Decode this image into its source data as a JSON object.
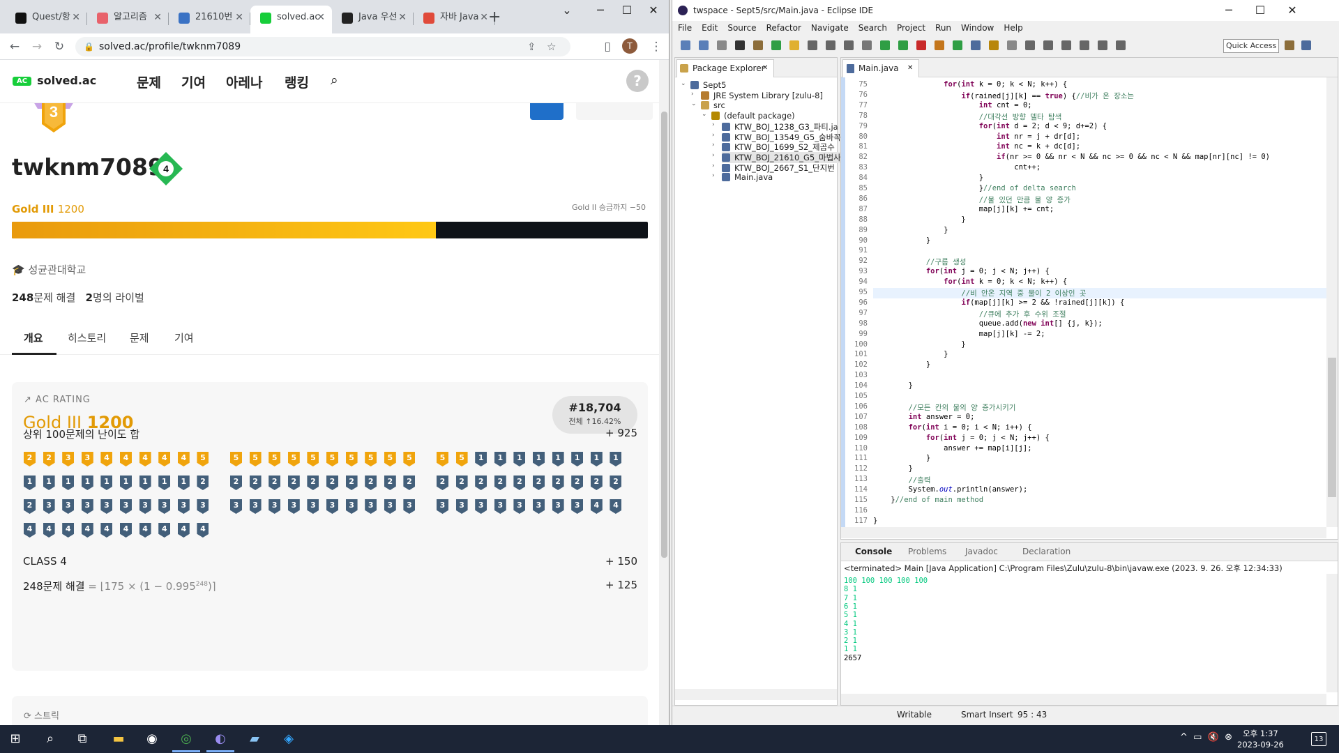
{
  "chrome": {
    "tabs": [
      {
        "label": "Quest/항",
        "fav_color": "#111111"
      },
      {
        "label": "알고리즘",
        "fav_color": "#e8626b"
      },
      {
        "label": "21610번",
        "fav_color": "#3a72c4"
      },
      {
        "label": "solved.ac",
        "fav_color": "#17ce3a",
        "active": true
      },
      {
        "label": "Java 우선",
        "fav_color": "#222222"
      },
      {
        "label": "자바 Java",
        "fav_color": "#e04a3a"
      }
    ],
    "url": "solved.ac/profile/twknm7089",
    "avatar_letter": "T"
  },
  "site": {
    "logo_badge": "AC",
    "logo": "solved.ac",
    "menu": [
      "문제",
      "기여",
      "아레나",
      "랭킹"
    ],
    "help": "?",
    "tier_badge_num": "3",
    "username": "twknm7089",
    "level": "4",
    "tier_name": "Gold III",
    "tier_rating": "1200",
    "next_tier": "Gold II 승급까지 −50",
    "progress": 0.667,
    "school": "성균관대학교",
    "solved_count": "248",
    "solved_label": "문제 해결",
    "rival_count": "2",
    "rival_label": "명의 라이벌",
    "tabs": [
      "개요",
      "히스토리",
      "문제",
      "기여"
    ],
    "card": {
      "header": "AC RATING",
      "tier_name": "Gold III",
      "rating": "1200",
      "rank": "#18,704",
      "rank_sub": "전체 ↑16.42%",
      "top100_label": "상위 100문제의 난이도 합",
      "top100_value": "+ 925",
      "class_label": "CLASS 4",
      "class_value": "+ 150",
      "solved_formula_a": "248문제 해결",
      "solved_formula_b": " = ⌊175 × (1 − 0.995",
      "solved_formula_sup": "248",
      "solved_formula_c": ")⌉",
      "solved_value": "+ 125"
    },
    "streak_label": "스트릭",
    "badge_rows": [
      [
        "g2",
        "g2",
        "g3",
        "g3",
        "g4",
        "g4",
        "g4",
        "g4",
        "g4",
        "g5"
      ],
      [
        "g5",
        "g5",
        "g5",
        "g5",
        "g5",
        "g5",
        "g5",
        "g5",
        "g5",
        "g5"
      ],
      [
        "g5",
        "g5",
        "s1",
        "s1",
        "s1",
        "s1",
        "s1",
        "s1",
        "s1",
        "s1"
      ],
      [
        "s1",
        "s1",
        "s1",
        "s1",
        "s1",
        "s1",
        "s1",
        "s1",
        "s1",
        "s2"
      ],
      [
        "s2",
        "s2",
        "s2",
        "s2",
        "s2",
        "s2",
        "s2",
        "s2",
        "s2",
        "s2"
      ],
      [
        "s2",
        "s2",
        "s2",
        "s2",
        "s2",
        "s2",
        "s2",
        "s2",
        "s2",
        "s2"
      ],
      [
        "s2",
        "s3",
        "s3",
        "s3",
        "s3",
        "s3",
        "s3",
        "s3",
        "s3",
        "s3"
      ],
      [
        "s3",
        "s3",
        "s3",
        "s3",
        "s3",
        "s3",
        "s3",
        "s3",
        "s3",
        "s3"
      ],
      [
        "s3",
        "s3",
        "s3",
        "s3",
        "s3",
        "s3",
        "s3",
        "s3",
        "s4",
        "s4"
      ],
      [
        "s4",
        "s4",
        "s4",
        "s4",
        "s4",
        "s4",
        "s4",
        "s4",
        "s4",
        "s4"
      ]
    ],
    "badge_colors": {
      "gold": "#f0a40c",
      "silver": "#435f7a"
    }
  },
  "eclipse": {
    "title": "twspace - Sept5/src/Main.java - Eclipse IDE",
    "menu": [
      "File",
      "Edit",
      "Source",
      "Refactor",
      "Navigate",
      "Search",
      "Project",
      "Run",
      "Window",
      "Help"
    ],
    "quick_access": "Quick Access",
    "pkg_tab": "Package Explorer",
    "tree": [
      {
        "label": "Sept5",
        "depth": 0
      },
      {
        "label": "JRE System Library [zulu-8]",
        "depth": 1
      },
      {
        "label": "src",
        "depth": 1
      },
      {
        "label": "(default package)",
        "depth": 2
      },
      {
        "label": "KTW_BOJ_1238_G3_파티.ja",
        "depth": 3
      },
      {
        "label": "KTW_BOJ_13549_G5_숨바꼭",
        "depth": 3
      },
      {
        "label": "KTW_BOJ_1699_S2_제곱수",
        "depth": 3
      },
      {
        "label": "KTW_BOJ_21610_G5_마법사",
        "depth": 3
      },
      {
        "label": "KTW_BOJ_2667_S1_단지번",
        "depth": 3
      },
      {
        "label": "Main.java",
        "depth": 3
      }
    ],
    "editor_tab": "Main.java",
    "line_numbers": [
      "75",
      "76",
      "77",
      "78",
      "79",
      "80",
      "81",
      "82",
      "83",
      "84",
      "85",
      "86",
      "87",
      "88",
      "89",
      "90",
      "91",
      "92",
      "93",
      "94",
      "95",
      "96",
      "97",
      "98",
      "99",
      "100",
      "101",
      "102",
      "103",
      "104",
      "105",
      "106",
      "107",
      "108",
      "109",
      "110",
      "111",
      "112",
      "113",
      "114",
      "115",
      "116",
      "117"
    ],
    "code_lines": [
      "                for(int k = 0; k < N; k++) {",
      "                    if(rained[j][k] == true) {//비가 온 장소는",
      "                        int cnt = 0;",
      "                        //대각선 방향 델타 탐색",
      "                        for(int d = 2; d < 9; d+=2) {",
      "                            int nr = j + dr[d];",
      "                            int nc = k + dc[d];",
      "                            if(nr >= 0 && nr < N && nc >= 0 && nc < N && map[nr][nc] != 0)",
      "                                cnt++;",
      "                        }",
      "                        }//end of delta search",
      "                        //물 있던 만큼 물 양 증가",
      "                        map[j][k] += cnt;",
      "                    }",
      "                }",
      "            }",
      "",
      "            //구름 생성",
      "            for(int j = 0; j < N; j++) {",
      "                for(int k = 0; k < N; k++) {",
      "                    //비 안온 지역 중 물이 2 이상인 곳",
      "                    if(map[j][k] >= 2 && !rained[j][k]) {",
      "                        //큐에 추가 후 수위 조절",
      "                        queue.add(new int[] {j, k});",
      "                        map[j][k] -= 2;",
      "                    }",
      "                }",
      "            }",
      "",
      "        }",
      "",
      "        //모든 칸의 물의 양 증가시키기",
      "        int answer = 0;",
      "        for(int i = 0; i < N; i++) {",
      "            for(int j = 0; j < N; j++) {",
      "                answer += map[i][j];",
      "            }",
      "        }",
      "        //출력",
      "        System.out.println(answer);",
      "    }//end of main method",
      "",
      "}"
    ],
    "console_tabs": [
      "Console",
      "Problems",
      "Javadoc",
      "Declaration"
    ],
    "terminated": "<terminated> Main [Java Application] C:\\Program Files\\Zulu\\zulu-8\\bin\\javaw.exe (2023. 9. 26. 오후 12:34:33)",
    "console_lines": [
      {
        "text": "100 100 100 100 100",
        "input": true
      },
      {
        "text": "8 1",
        "input": true
      },
      {
        "text": "7 1",
        "input": true
      },
      {
        "text": "6 1",
        "input": true
      },
      {
        "text": "5 1",
        "input": true
      },
      {
        "text": "4 1",
        "input": true
      },
      {
        "text": "3 1",
        "input": true
      },
      {
        "text": "2 1",
        "input": true
      },
      {
        "text": "1 1",
        "input": true
      },
      {
        "text": "2657",
        "input": false
      }
    ],
    "status": {
      "mode": "Writable",
      "insert": "Smart Insert",
      "pos": "95 : 43"
    }
  },
  "taskbar": {
    "time": "오후 1:37",
    "date": "2023-09-26",
    "notifications": "13"
  }
}
